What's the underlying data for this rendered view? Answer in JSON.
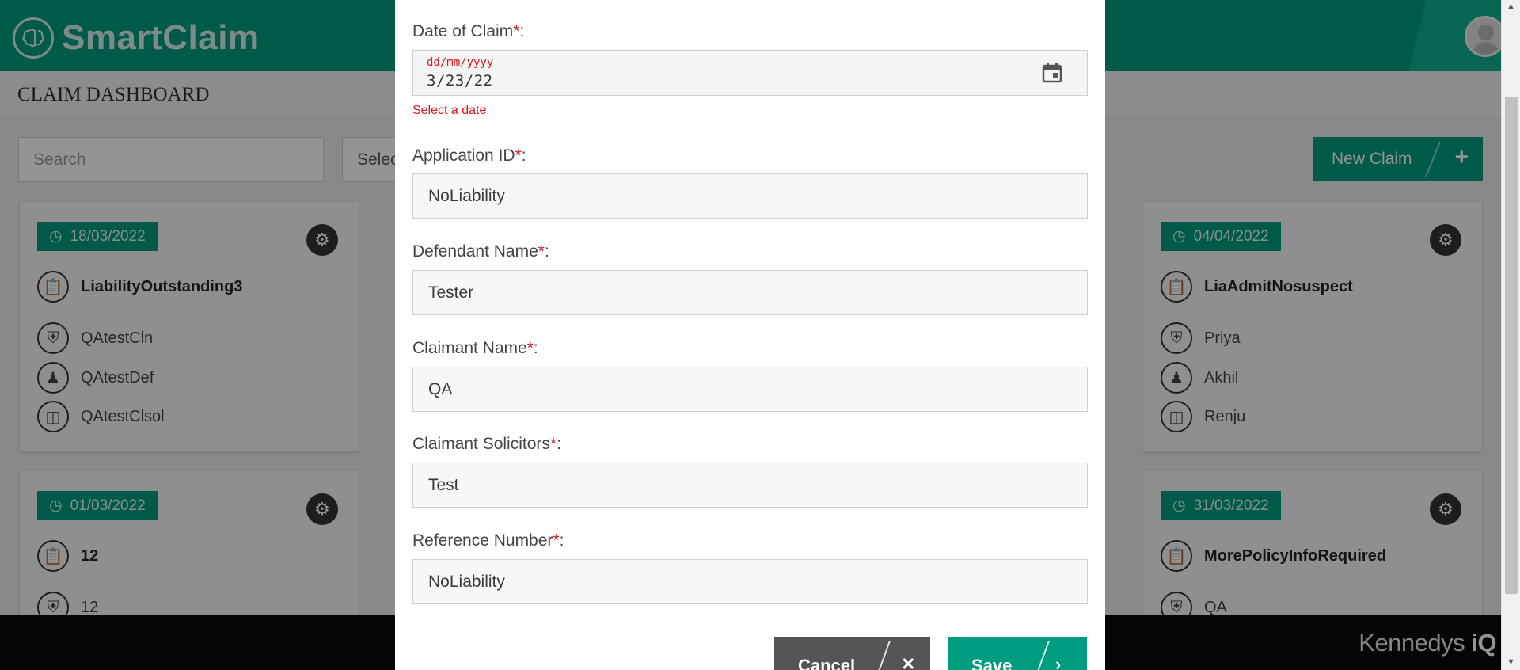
{
  "app": {
    "brand": "SmartClaim",
    "section_title": "CLAIM DASHBOARD",
    "search_placeholder": "Search",
    "select_label": "Selec",
    "new_claim_label": "New Claim",
    "footer_brand_prefix": "Kennedys ",
    "footer_brand_suffix": "iQ"
  },
  "cards": [
    {
      "date": "18/03/2022",
      "title": "LiabilityOutstanding3",
      "claimant": "QAtestCln",
      "defendant": "QAtestDef",
      "solicitor": "QAtestClsol"
    },
    {
      "date": "04/04/2022",
      "title": "LiaAdmitNosuspect",
      "claimant": "Priya",
      "defendant": "Akhil",
      "solicitor": "Renju"
    },
    {
      "date": "01/03/2022",
      "title": "12",
      "claimant": "12"
    },
    {
      "date": "31/03/2022",
      "title": "MorePolicyInfoRequired",
      "claimant": "QA"
    }
  ],
  "modal": {
    "date_label": "Date of Claim",
    "date_placeholder": "dd/mm/yyyy",
    "date_value": "3/23/22",
    "date_error": "Select a date",
    "application_id_label": "Application ID",
    "application_id_value": "NoLiability",
    "defendant_label": "Defendant Name",
    "defendant_value": "Tester",
    "claimant_label": "Claimant Name",
    "claimant_value": "QA",
    "solicitors_label": "Claimant Solicitors",
    "solicitors_value": "Test",
    "reference_label": "Reference Number",
    "reference_value": "NoLiability",
    "required_mark": "*",
    "colon": ":",
    "cancel_label": "Cancel",
    "save_label": "Save"
  },
  "colors": {
    "brand_green": "#009c7f",
    "required_red": "#e0141e",
    "cancel_gray": "#555555"
  },
  "icons": {
    "logo": "brain-icon",
    "date": "clock-icon",
    "settings": "gears-icon",
    "title": "clipboard-icon",
    "claimant": "shield-icon",
    "defendant": "person-icon",
    "solicitor": "bank-icon",
    "calendar": "calendar-icon"
  }
}
